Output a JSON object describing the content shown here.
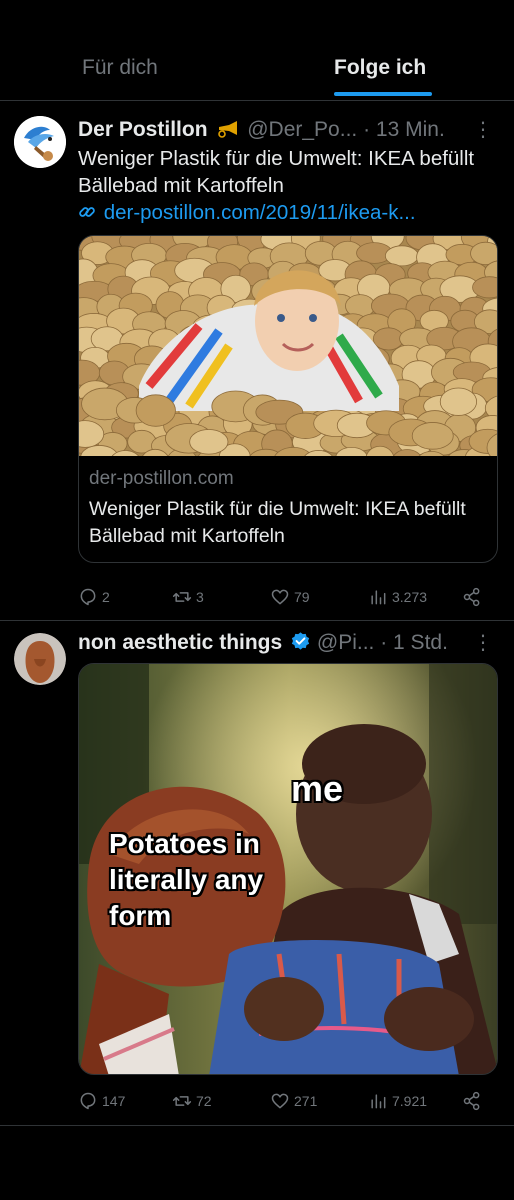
{
  "tabs": [
    {
      "label": "Für dich",
      "active": false
    },
    {
      "label": "Folge ich",
      "active": true
    }
  ],
  "accent_color": "#1d9bf0",
  "tweets": [
    {
      "display_name": "Der Postillon",
      "badge_icon": "horn-icon",
      "handle": "@Der_Po...",
      "time": "13 Min.",
      "text": "Weniger Plastik für die Umwelt: IKEA befüllt Bällebad mit Kartoffeln",
      "link": "der-postillon.com/2019/11/ikea-k...",
      "card": {
        "domain": "der-postillon.com",
        "title": "Weniger Plastik für die Umwelt: IKEA befüllt Bällebad mit Kartoffeln"
      },
      "stats": {
        "replies": "2",
        "reposts": "3",
        "likes": "79",
        "views": "3.273"
      }
    },
    {
      "display_name": "non aesthetic things",
      "badge_icon": "verified-icon",
      "handle": "@Pi...",
      "time": "1 Std.",
      "meme": {
        "label_top": "me",
        "label_left": "Potatoes in literally any form"
      },
      "stats": {
        "replies": "147",
        "reposts": "72",
        "likes": "271",
        "views": "7.921"
      }
    }
  ]
}
